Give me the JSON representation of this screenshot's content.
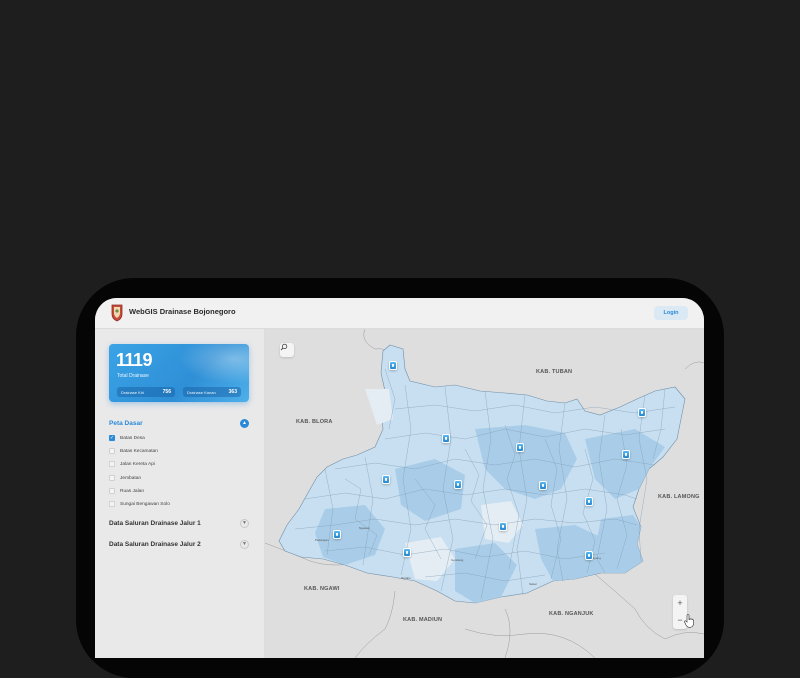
{
  "app": {
    "title": "WebGIS Drainase Bojonegoro",
    "login_label": "Login"
  },
  "stats": {
    "total": "1119",
    "total_label": "Total Drainase",
    "pills": [
      {
        "label": "Drainase Kiri",
        "value": "756"
      },
      {
        "label": "Drainase Kanan",
        "value": "363"
      }
    ]
  },
  "sidebar": {
    "peta_dasar": {
      "title": "Peta Dasar",
      "layers": [
        {
          "label": "Batas Desa",
          "checked": true
        },
        {
          "label": "Batas Kecamatan",
          "checked": false
        },
        {
          "label": "Jalan Kereta Api",
          "checked": false
        },
        {
          "label": "Jembatan",
          "checked": false
        },
        {
          "label": "Ruas Jalan",
          "checked": false
        },
        {
          "label": "Sungai Bengawan Solo",
          "checked": false
        }
      ]
    },
    "jalur1": {
      "title": "Data Saluran Drainase Jalur 1"
    },
    "jalur2": {
      "title": "Data Saluran Drainase Jalur 2"
    }
  },
  "map": {
    "regions": {
      "tuban": "KAB. TUBAN",
      "blora": "KAB. BLORA",
      "lamongan": "KAB. LAMONG",
      "ngawi": "KAB. NGAWI",
      "madiun": "KAB. MADIUN",
      "nganjuk": "KAB. NGANJUK"
    },
    "colors": {
      "accent": "#2a8ad7",
      "district_fill": "#c7dff0",
      "district_fill_dark": "#a9cde8",
      "background": "#dedede"
    }
  }
}
